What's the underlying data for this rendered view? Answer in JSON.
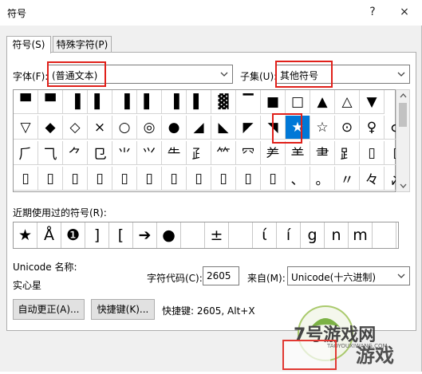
{
  "window": {
    "title": "符号",
    "help": "?",
    "close": "×"
  },
  "tabs": [
    {
      "label": "符号(S)",
      "active": true
    },
    {
      "label": "特殊字符(P)",
      "active": false
    }
  ],
  "font": {
    "label": "字体(F):",
    "value": "(普通文本)"
  },
  "subset": {
    "label": "子集(U):",
    "value": "其他符号"
  },
  "symbols": [
    [
      "▀",
      "▀",
      "▐",
      "▌",
      "▐",
      "▌",
      "▐",
      "▌",
      "▓",
      "▔",
      "■",
      "□",
      "▲",
      "△",
      "▼"
    ],
    [
      "▽",
      "◆",
      "◇",
      "×",
      "○",
      "◎",
      "●",
      "◢",
      "◣",
      "◤",
      "◥",
      "★",
      "☆",
      "⊙",
      "♀",
      "♂"
    ],
    [
      "⺁",
      "⺄",
      "⺈",
      "⺋",
      "⺌",
      "⺍",
      "⺧",
      "⺪",
      "⺮",
      "⺳",
      "⺶",
      "⺷",
      "⺻",
      "⻊",
      "▯",
      "▯"
    ],
    [
      "▯",
      "▯",
      "▯",
      "▯",
      "▯",
      "▯",
      "▯",
      "▯",
      "▯",
      "▯",
      "▯",
      "、",
      "。",
      "〃",
      "々",
      "〆"
    ]
  ],
  "recent": {
    "label": "近期使用过的符号(R):",
    "items": [
      "★",
      "Å",
      "❶",
      "]",
      "[",
      "➔",
      "●",
      "",
      "±",
      "",
      "ί",
      "í",
      "g",
      "n",
      "m",
      ""
    ]
  },
  "unicode_name": {
    "label": "Unicode 名称:",
    "value": "实心星"
  },
  "char_code": {
    "label": "字符代码(C):",
    "value": "2605"
  },
  "from": {
    "label": "来自(M):",
    "value": "Unicode(十六进制)"
  },
  "buttons": {
    "autocorrect": "自动更正(A)...",
    "shortcut_key": "快捷键(K)..."
  },
  "shortcut_text": "快捷键: 2605, Alt+X",
  "watermark": {
    "text1": "7号游戏网",
    "text2": "游戏",
    "url": "TAOYOUXIWANG.COM"
  }
}
